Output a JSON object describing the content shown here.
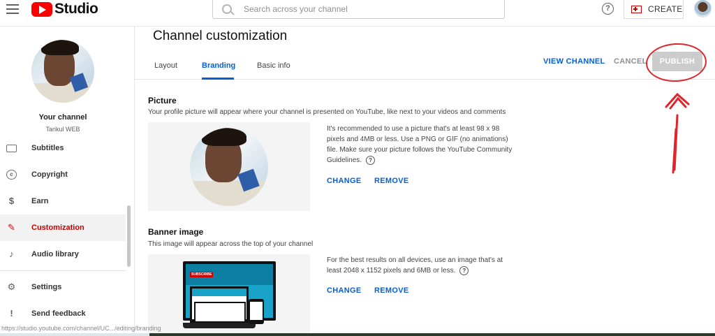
{
  "header": {
    "app_name": "Studio",
    "search": {
      "placeholder": "Search across your channel"
    },
    "help_icon": "?",
    "create_label": "CREATE"
  },
  "sidebar": {
    "your_channel": "Your channel",
    "channel_name": "Tarikul WEB",
    "items": [
      {
        "label": "Subtitles",
        "icon": "subtitles-icon"
      },
      {
        "label": "Copyright",
        "icon": "copyright-icon",
        "glyph": "c"
      },
      {
        "label": "Earn",
        "icon": "dollar-icon",
        "glyph": "$"
      },
      {
        "label": "Customization",
        "icon": "magic-wand-icon",
        "glyph": "✎",
        "active": true
      },
      {
        "label": "Audio library",
        "icon": "music-icon",
        "glyph": "♪"
      },
      {
        "label": "Settings",
        "icon": "gear-icon",
        "glyph": "⚙"
      },
      {
        "label": "Send feedback",
        "icon": "feedback-icon",
        "glyph": "!"
      }
    ]
  },
  "main": {
    "title": "Channel customization",
    "tabs": [
      {
        "label": "Layout"
      },
      {
        "label": "Branding",
        "active": true
      },
      {
        "label": "Basic info"
      }
    ],
    "actions": {
      "view_channel": "VIEW CHANNEL",
      "cancel": "CANCEL",
      "publish": "PUBLISH"
    },
    "picture": {
      "title": "Picture",
      "description": "Your profile picture will appear where your channel is presented on YouTube, like next to your videos and comments",
      "info": "It's recommended to use a picture that's at least 98 x 98 pixels and 4MB or less. Use a PNG or GIF (no animations) file. Make sure your picture follows the YouTube Community Guidelines.",
      "change": "CHANGE",
      "remove": "REMOVE"
    },
    "banner": {
      "title": "Banner image",
      "description": "This image will appear across the top of your channel",
      "info": "For the best results on all devices, use an image that's at least 2048 x 1152 pixels and 6MB or less.",
      "change": "CHANGE",
      "remove": "REMOVE",
      "subscribe_text": "SUBSCRIBE"
    }
  },
  "statusbar": {
    "url": "https://studio.youtube.com/channel/UC.../editing/branding"
  },
  "colors": {
    "accent": "#065fd4",
    "brand": "#ff0000",
    "annotation": "#e0242b"
  }
}
